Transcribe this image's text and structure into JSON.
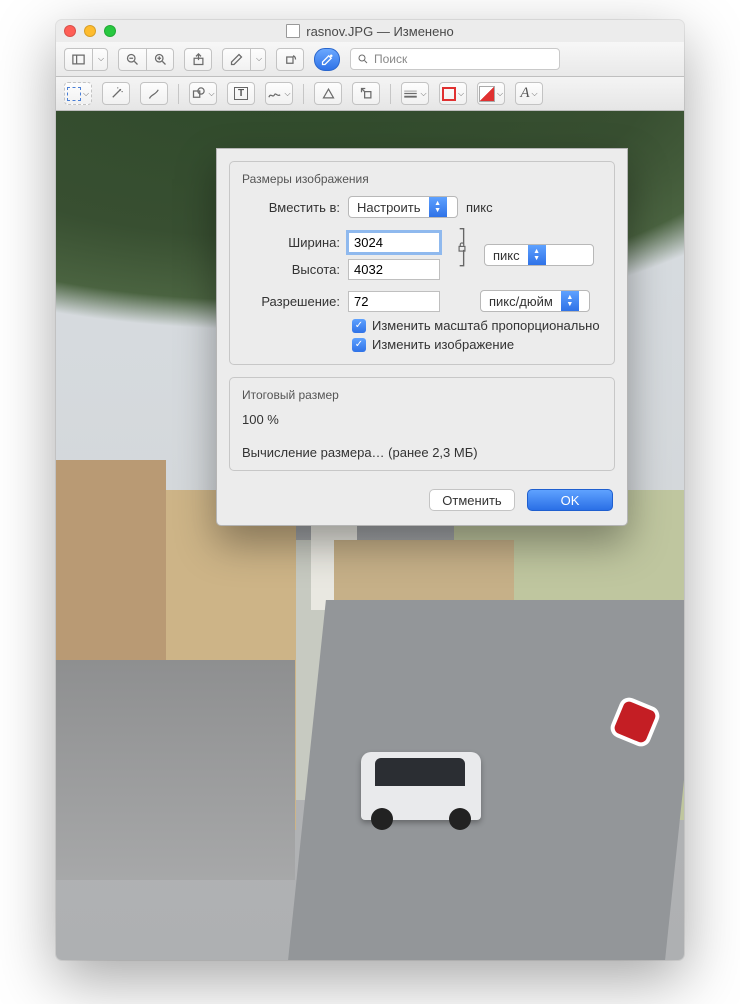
{
  "title": {
    "filename": "rasnov.JPG",
    "status": "Изменено"
  },
  "search": {
    "placeholder": "Поиск"
  },
  "dialog": {
    "group_title": "Размеры изображения",
    "fit_label": "Вместить в:",
    "fit_value": "Настроить",
    "fit_unit": "пикс",
    "width_label": "Ширина:",
    "width_value": "3024",
    "height_label": "Высота:",
    "height_value": "4032",
    "dim_unit": "пикс",
    "res_label": "Разрешение:",
    "res_value": "72",
    "res_unit": "пикс/дюйм",
    "scale_prop": "Изменить масштаб пропорционально",
    "resample": "Изменить изображение",
    "result_title": "Итоговый размер",
    "result_percent": "100 %",
    "result_calc": "Вычисление размера… (ранее 2,3 МБ)",
    "cancel": "Отменить",
    "ok": "OK"
  }
}
